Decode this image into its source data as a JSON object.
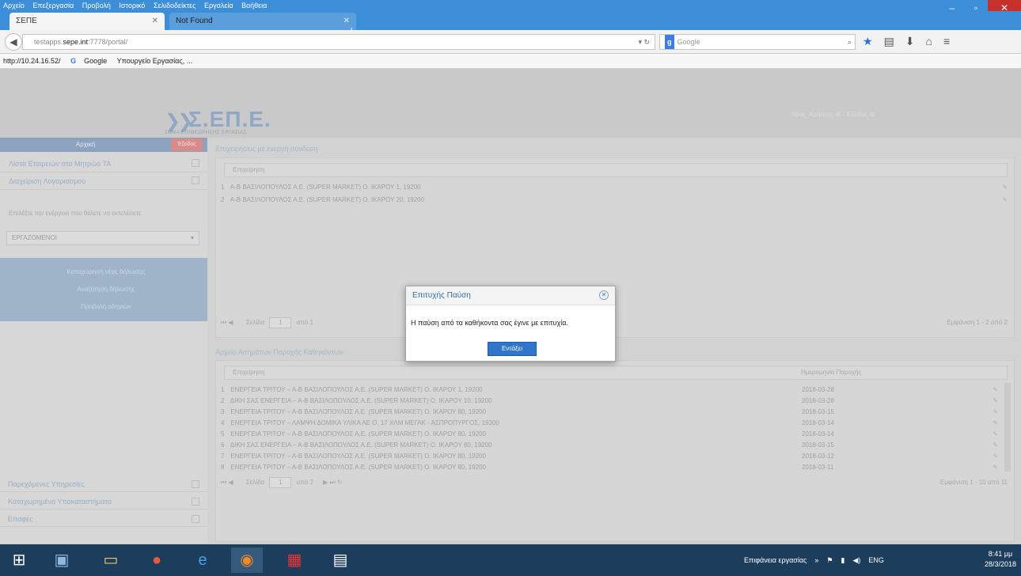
{
  "browser": {
    "menu": [
      "Αρχείο",
      "Επεξεργασία",
      "Προβολή",
      "Ιστορικό",
      "Σελιδοδείκτες",
      "Εργαλεία",
      "Βοήθεια"
    ],
    "tabs": [
      {
        "label": "ΣΕΠΕ",
        "active": true
      },
      {
        "label": "Not Found",
        "active": false
      }
    ],
    "url_prefix": "testapps.",
    "url_domain": "sepe.int",
    "url_suffix": ":7778/portal/",
    "search_placeholder": "Google",
    "bookmarks": [
      "http://10.24.16.52/",
      "Google",
      "Υπουργείο Εργασίας, ..."
    ]
  },
  "header": {
    "logo_text": "Σ.ΕΠ.Ε.",
    "logo_slogan": "ΣΩΜΑ ΕΠΙΘΕΩΡΗΣΗΣ ΕΡΓΑΣΙΑΣ",
    "user_links": "Νέος_Χρήστης ⚙ · Έξοδος ⚙"
  },
  "sidebar": {
    "title": "Αρχική",
    "badge": "Έξοδος",
    "links": [
      "Λίστα Εταιρειών στο Μητρώο ΤΑ",
      "Διαχείριση Λογαριασμού"
    ],
    "note": "Επιλέξτε την ενέργεια που θέλετε να εκτελέσετε",
    "select_value": "ΕΡΓΑΖΟΜΕΝΟΙ",
    "actions": [
      "Καταχώρηση νέας δήλωσης",
      "Αναζήτηση δήλωσης",
      "Προβολή οδηγιών"
    ],
    "bottom_links": [
      "Παρεχόμενες Υπηρεσίες",
      "Καταχωρημένα Υποκαταστήματα",
      "Επαφές"
    ]
  },
  "panel1": {
    "title": "Επιχειρήσεις με ενεργή σύνδεση",
    "column": "Επιχείρηση",
    "rows": [
      {
        "num": "1",
        "text": "Α-Β ΒΑΣΙΛΟΠΟΥΛΟΣ Α.Ε. (SUPER MARKET) Ο. ΙΚΑΡΟΥ 1, 19200"
      },
      {
        "num": "2",
        "text": "Α-Β ΒΑΣΙΛΟΠΟΥΛΟΣ Α.Ε. (SUPER MARKET) Ο. ΙΚΑΡΟΥ 20, 19200"
      }
    ],
    "pager_label": "Σελίδα",
    "pager_page": "1",
    "pager_of": "από 1",
    "pager_right": "Εμφάνιση 1 - 2 από 2"
  },
  "panel2": {
    "title": "Αρχείο Αιτημάτων Παροχής Καθηκόντων",
    "col1": "Επιχείρηση",
    "col2": "Ημερομηνία Παροχής",
    "rows": [
      {
        "num": "1",
        "text": "ΕΝΕΡΓΕΙΑ ΤΡΙΤΟΥ – Α-Β ΒΑΣΙΛΟΠΟΥΛΟΣ Α.Ε. (SUPER MARKET) Ο. ΙΚΑΡΟΥ 1, 19200",
        "date": "2018-03-28"
      },
      {
        "num": "2",
        "text": "ΔΙΚΗ ΣΑΣ ΕΝΕΡΓΕΙΑ – Α-Β ΒΑΣΙΛΟΠΟΥΛΟΣ Α.Ε. (SUPER MARKET) Ο. ΙΚΑΡΟΥ 10, 19200",
        "date": "2018-03-28"
      },
      {
        "num": "3",
        "text": "ΕΝΕΡΓΕΙΑ ΤΡΙΤΟΥ – Α-Β ΒΑΣΙΛΟΠΟΥΛΟΣ Α.Ε. (SUPER MARKET) Ο. ΙΚΑΡΟΥ 80, 19200",
        "date": "2018-03-15"
      },
      {
        "num": "4",
        "text": "ΕΝΕΡΓΕΙΑ ΤΡΙΤΟΥ – ΛΑΜΨΗ ΔΟΜΙΚΑ ΥΛΙΚΑ ΑΕ Ο. 17 ΧΛΜ ΜΕΓΑΚ - ΑΣΠΡΟΠΥΡΓΟΣ, 19300",
        "date": "2018-03-14"
      },
      {
        "num": "5",
        "text": "ΕΝΕΡΓΕΙΑ ΤΡΙΤΟΥ – Α-Β ΒΑΣΙΛΟΠΟΥΛΟΣ Α.Ε. (SUPER MARKET) Ο. ΙΚΑΡΟΥ 80, 19200",
        "date": "2018-03-14"
      },
      {
        "num": "6",
        "text": "ΔΙΚΗ ΣΑΣ ΕΝΕΡΓΕΙΑ – Α-Β ΒΑΣΙΛΟΠΟΥΛΟΣ Α.Ε. (SUPER MARKET) Ο. ΙΚΑΡΟΥ 80, 19200",
        "date": "2018-03-15"
      },
      {
        "num": "7",
        "text": "ΕΝΕΡΓΕΙΑ ΤΡΙΤΟΥ – Α-Β ΒΑΣΙΛΟΠΟΥΛΟΣ Α.Ε. (SUPER MARKET) Ο. ΙΚΑΡΟΥ 80, 19200",
        "date": "2018-03-12"
      },
      {
        "num": "8",
        "text": "ΕΝΕΡΓΕΙΑ ΤΡΙΤΟΥ – Α-Β ΒΑΣΙΛΟΠΟΥΛΟΣ Α.Ε. (SUPER MARKET) Ο. ΙΚΑΡΟΥ 80, 19200",
        "date": "2018-03-11"
      }
    ],
    "pager_label": "Σελίδα",
    "pager_page": "1",
    "pager_of": "από 2",
    "pager_right": "Εμφάνιση 1 - 10 από 11"
  },
  "modal": {
    "title": "Επιτυχής Παύση",
    "message": "Η παύση από τα καθήκοντα σας έγινε με επιτυχία.",
    "ok": "Εντάξει"
  },
  "taskbar": {
    "tray_label": "Επιφάνεια εργασίας",
    "lang": "ENG",
    "time": "8:41 μμ",
    "date": "28/3/2018"
  }
}
